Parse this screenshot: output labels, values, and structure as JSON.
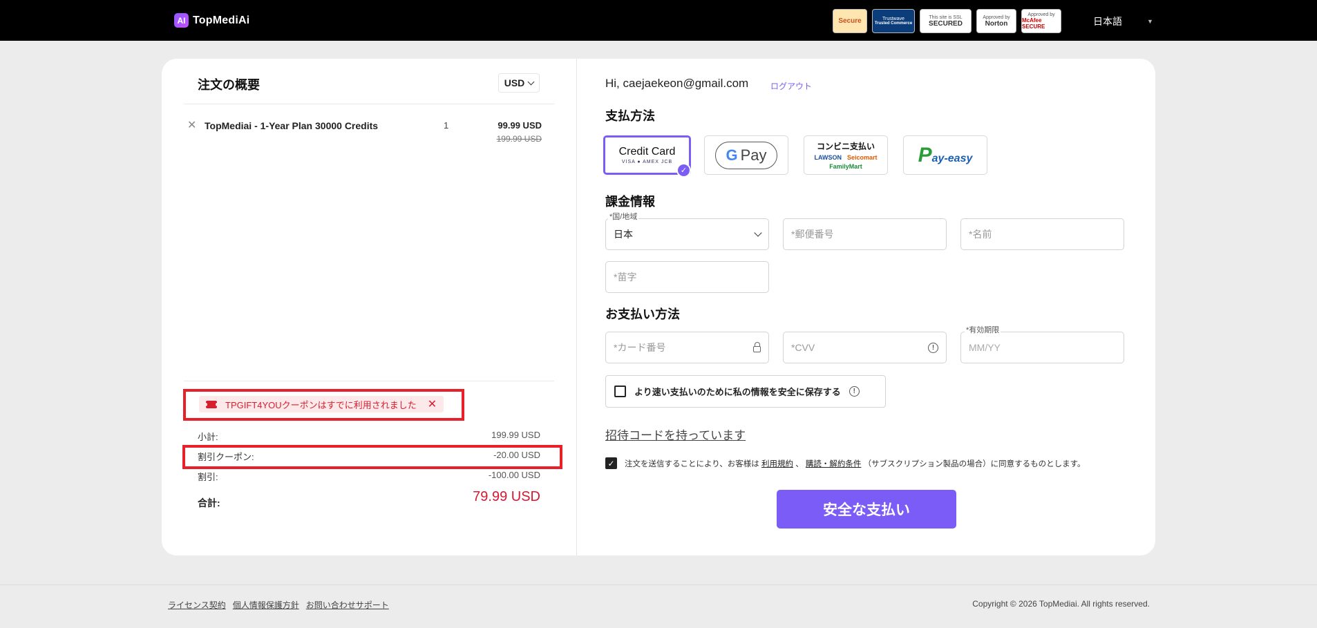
{
  "header": {
    "logo_mark": "AI",
    "logo_text": "TopMediAi",
    "badges": [
      {
        "top": "",
        "main": "Secure"
      },
      {
        "top": "Trustwave",
        "main": "Trusted Commerce"
      },
      {
        "top": "This site is SSL",
        "main": "SECURED"
      },
      {
        "top": "Approved by",
        "main": "Norton"
      },
      {
        "top": "Approved by",
        "main": "McAfee SECURE"
      }
    ],
    "language": "日本語"
  },
  "summary": {
    "title": "注文の概要",
    "currency": "USD",
    "item": {
      "name": "TopMediai - 1-Year Plan 30000 Credits",
      "qty": "1",
      "price": "99.99 USD",
      "old_price": "199.99 USD"
    },
    "coupon_message": "TPGIFT4YOUクーポンはすでに利用されました",
    "rows": [
      {
        "label": "小計:",
        "value": "199.99 USD"
      },
      {
        "label": "割引クーポン:",
        "value": "-20.00 USD"
      },
      {
        "label": "割引:",
        "value": "-100.00 USD"
      }
    ],
    "total_label": "合計:",
    "total_value": "79.99 USD"
  },
  "checkout": {
    "greeting": "Hi, caejaekeon@gmail.com",
    "logout": "ログアウト",
    "payment_method_title": "支払方法",
    "payment_options": {
      "card_title": "Credit Card",
      "card_brands": "VISA ● AMEX JCB",
      "gpay": "Pay",
      "gpay_g": "G",
      "konbini_title": "コンビニ支払い",
      "konbini_brands": [
        "LAWSON",
        "Seicomart",
        "FamilyMart"
      ],
      "payeasy": "ay-easy",
      "payeasy_p": "P"
    },
    "billing_title": "課金情報",
    "country_label": "*国/地域",
    "country_value": "日本",
    "postal_placeholder": "*郵便番号",
    "first_name_placeholder": "*名前",
    "last_name_placeholder": "*苗字",
    "card_section_title": "お支払い方法",
    "card_number_placeholder": "*カード番号",
    "cvv_placeholder": "*CVV",
    "expiry_label": "*有効期限",
    "expiry_placeholder": "MM/YY",
    "save_info": "より速い支払いのために私の情報を安全に保存する",
    "invite_code": "招待コードを持っています",
    "terms_prefix": "注文を送信することにより、お客様は",
    "terms_link1": "利用規約",
    "terms_sep": "、",
    "terms_link2": "購読・解約条件",
    "terms_suffix": "（サブスクリプション製品の場合）に同意するものとします。",
    "pay_button": "安全な支払い"
  },
  "footer": {
    "links": [
      "ライセンス契約",
      "個人情報保護方針",
      "お問い合わせサポート"
    ],
    "copyright": "Copyright © 2026 TopMediai. All rights reserved."
  }
}
